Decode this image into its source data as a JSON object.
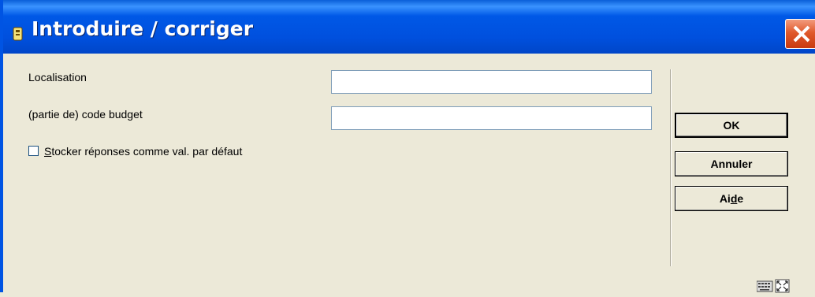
{
  "window": {
    "title": "Introduire / corriger",
    "icons": [
      "app-icon",
      "close-icon",
      "keyboard-icon",
      "maximize-icon"
    ]
  },
  "form": {
    "localisation_label": "Localisation",
    "localisation_value": "",
    "budget_label": "(partie de) code budget",
    "budget_value": "",
    "store_checkbox": {
      "mnemonic": "S",
      "rest": "tocker réponses comme val. par défaut",
      "checked": false
    }
  },
  "buttons": {
    "ok": "OK",
    "cancel": "Annuler",
    "help_before": "Ai",
    "help_mnemonic": "d",
    "help_after": "e"
  },
  "colors": {
    "titlebar": "#0054e3",
    "close": "#e05a2c",
    "dialog_bg": "#ece9d8"
  }
}
